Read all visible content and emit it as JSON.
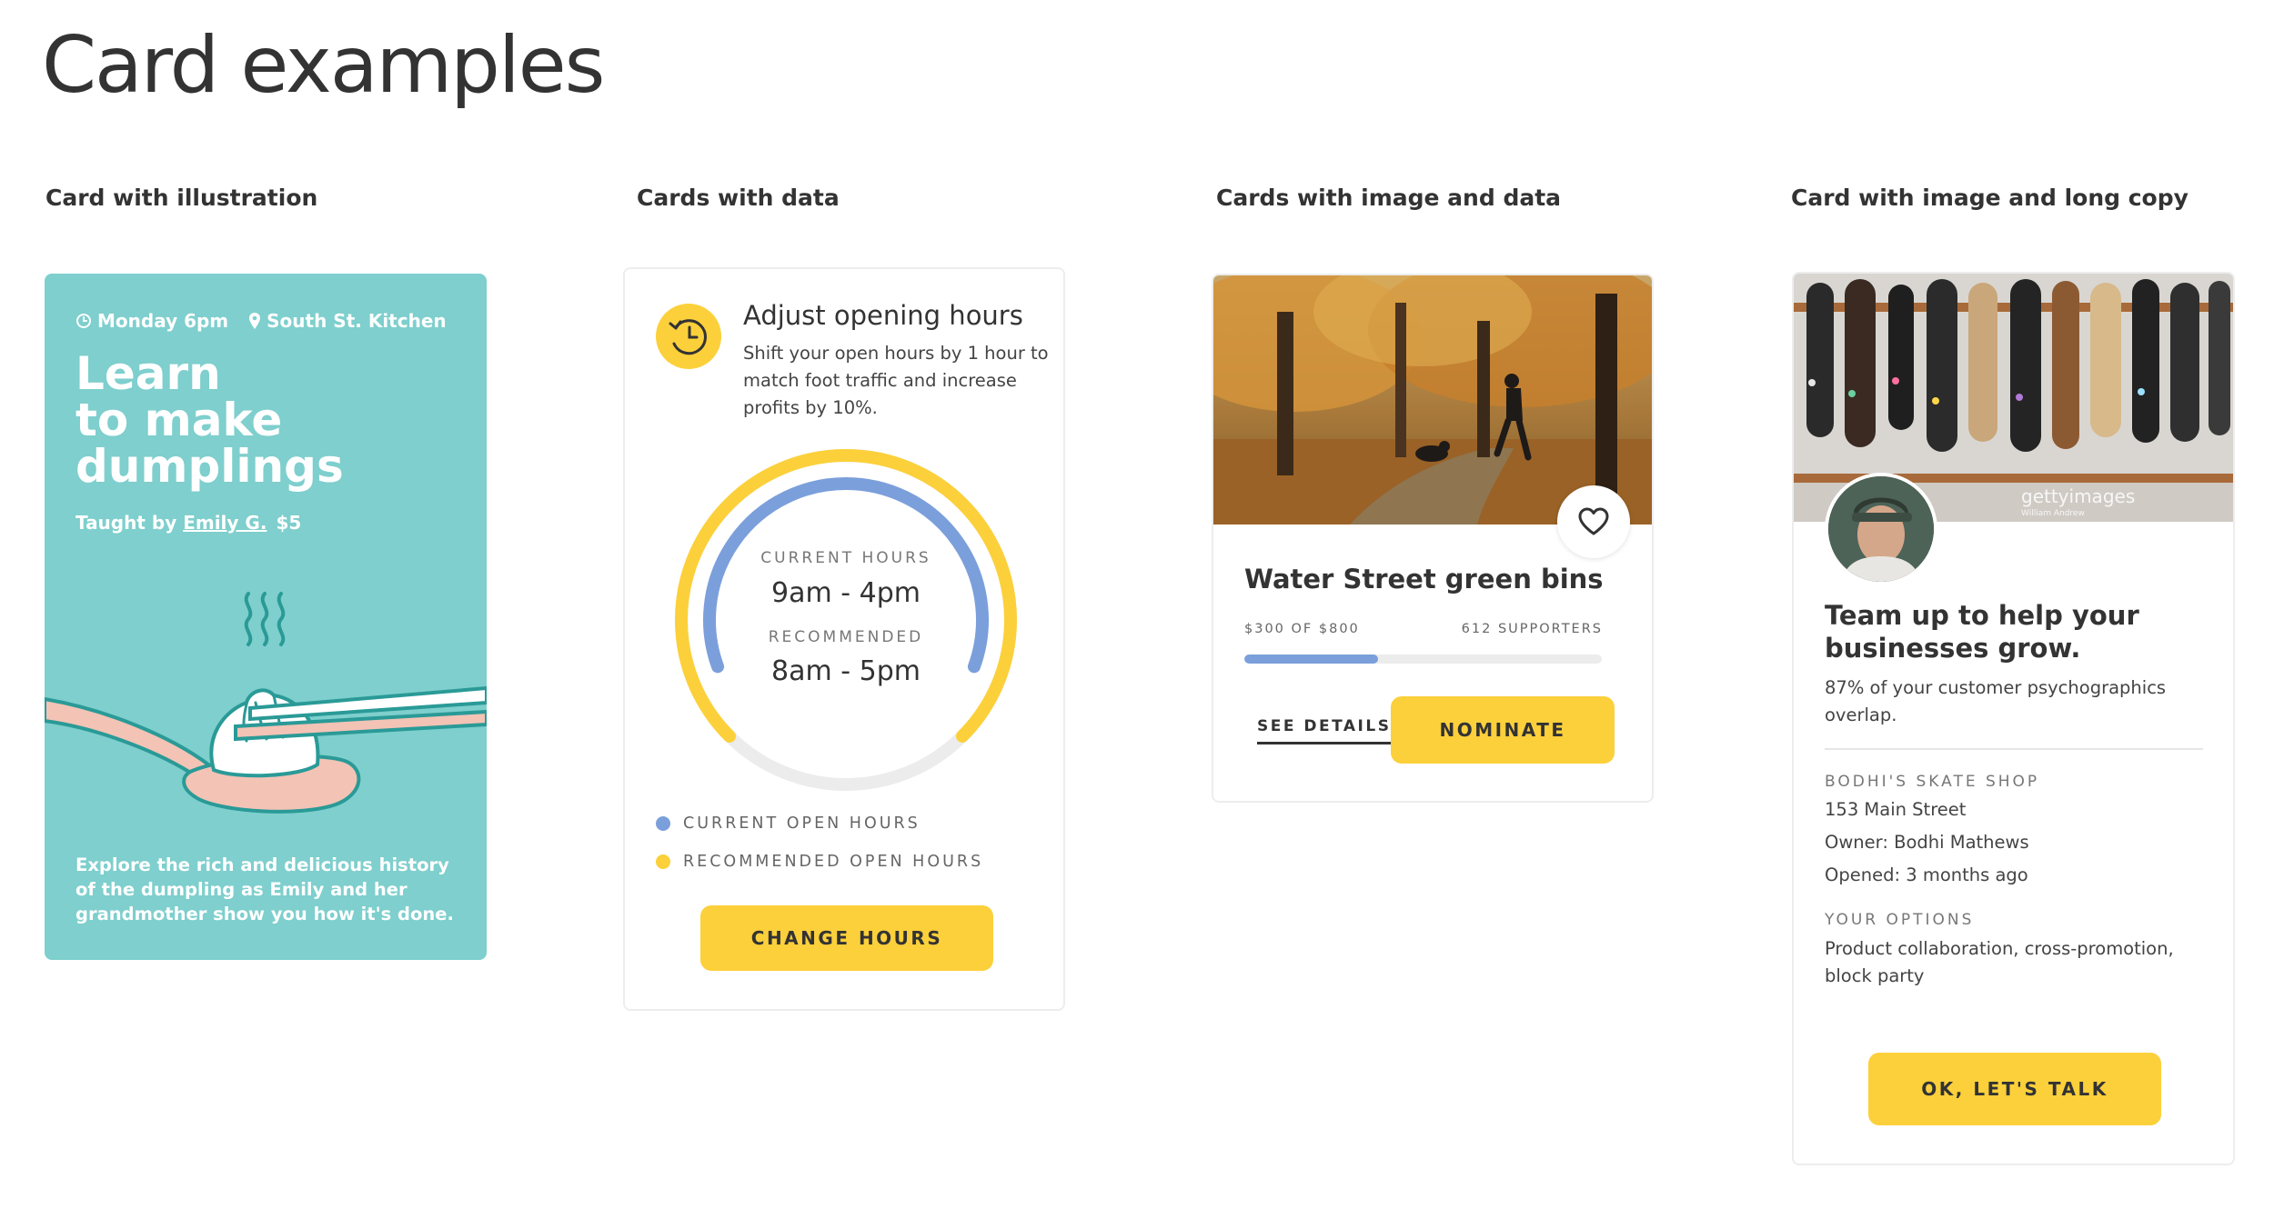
{
  "page": {
    "title": "Card examples"
  },
  "sections": {
    "illustration": "Card with illustration",
    "data": "Cards with data",
    "image_data": "Cards with image and data",
    "image_long": "Card with image and long copy"
  },
  "card_illustration": {
    "time": "Monday 6pm",
    "location": "South St. Kitchen",
    "title_line1": "Learn",
    "title_line2": "to make",
    "title_line3": "dumplings",
    "taught_prefix": "Taught by ",
    "teacher": "Emily G.",
    "price": "$5",
    "description": "Explore the rich and delicious history of the dumpling as Emily and her grandmother show you how it's done.",
    "background_color": "#7ecfcd",
    "icons": [
      "clock-icon",
      "location-pin-icon",
      "dumpling-illustration"
    ]
  },
  "card_data": {
    "heading": "Adjust opening hours",
    "description": "Shift your open hours by 1 hour to match foot traffic and increase profits by 10%.",
    "current_label": "CURRENT HOURS",
    "current_value": "9am - 4pm",
    "recommended_label": "RECOMMENDED",
    "recommended_value": "8am - 5pm",
    "legend_current": "CURRENT OPEN HOURS",
    "legend_recommended": "RECOMMENDED OPEN HOURS",
    "button": "CHANGE HOURS",
    "colors": {
      "current": "#7b9fdb",
      "recommended": "#fcd03a",
      "track": "#ececec"
    },
    "icons": [
      "clock-rewind-icon"
    ]
  },
  "card_image_data": {
    "heading": "Water Street green bins",
    "raised": "$300 OF $800",
    "supporters": "612 SUPPORTERS",
    "progress": 0.375,
    "link": "SEE DETAILS",
    "button": "NOMINATE",
    "icons": [
      "heart-icon"
    ]
  },
  "card_long": {
    "photo_watermark": "gettyimages",
    "photo_credit": "William Andrew",
    "heading": "Team up to help your businesses grow.",
    "description": "87% of your customer psychographics overlap.",
    "shop_label": "BODHI'S SKATE SHOP",
    "address": "153 Main Street",
    "owner": "Owner: Bodhi Mathews",
    "opened": "Opened: 3 months ago",
    "options_label": "YOUR OPTIONS",
    "options": "Product collaboration, cross-promotion, block party",
    "button": "OK, LET'S TALK"
  },
  "accent_color": "#fcd03a"
}
